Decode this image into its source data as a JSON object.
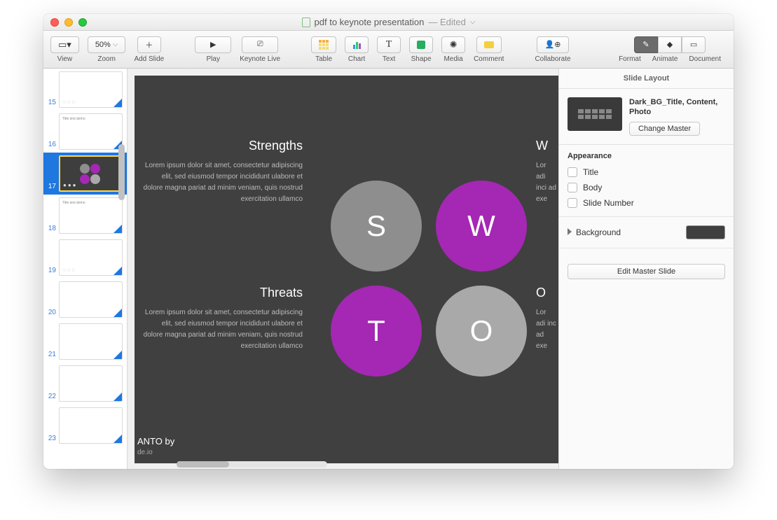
{
  "window": {
    "title": "pdf to keynote presentation",
    "edited": "— Edited"
  },
  "toolbar": {
    "view": "View",
    "zoom_value": "50%",
    "zoom": "Zoom",
    "add_slide": "Add Slide",
    "play": "Play",
    "keynote_live": "Keynote Live",
    "table": "Table",
    "chart": "Chart",
    "text": "Text",
    "shape": "Shape",
    "media": "Media",
    "comment": "Comment",
    "collaborate": "Collaborate",
    "format": "Format",
    "animate": "Animate",
    "document": "Document"
  },
  "thumbs": {
    "n15": "15",
    "n16": "16",
    "n17": "17",
    "n18": "18",
    "n19": "19",
    "n20": "20",
    "n21": "21",
    "n22": "22",
    "n23": "23",
    "title_placeholder": "Title text demo"
  },
  "slide": {
    "strengths": {
      "h": "Strengths",
      "p": "Lorem ipsum dolor sit amet, consectetur adipiscing elit, sed eiusmod tempor incididunt ulabore et dolore magna pariat ad minim veniam, quis nostrud exercitation ullamco"
    },
    "weak": {
      "h": "W",
      "p": "Lor adi inci ad exe"
    },
    "threats": {
      "h": "Threats",
      "p": "Lorem ipsum dolor sit amet, consectetur adipiscing elit, sed eiusmod tempor incididunt ulabore et dolore magna pariat ad minim veniam, quis nostrud exercitation ullamco"
    },
    "opp": {
      "h": "O",
      "p": "Lor adi inc ad exe"
    },
    "S": "S",
    "W": "W",
    "T": "T",
    "O": "O",
    "credit": "ANTO by",
    "credit2": "de.io"
  },
  "inspector": {
    "header": "Slide Layout",
    "master_name": "Dark_BG_Title, Content, Photo",
    "change_master": "Change Master",
    "appearance": "Appearance",
    "title": "Title",
    "body": "Body",
    "slide_number": "Slide Number",
    "background": "Background",
    "edit_master": "Edit Master Slide"
  }
}
